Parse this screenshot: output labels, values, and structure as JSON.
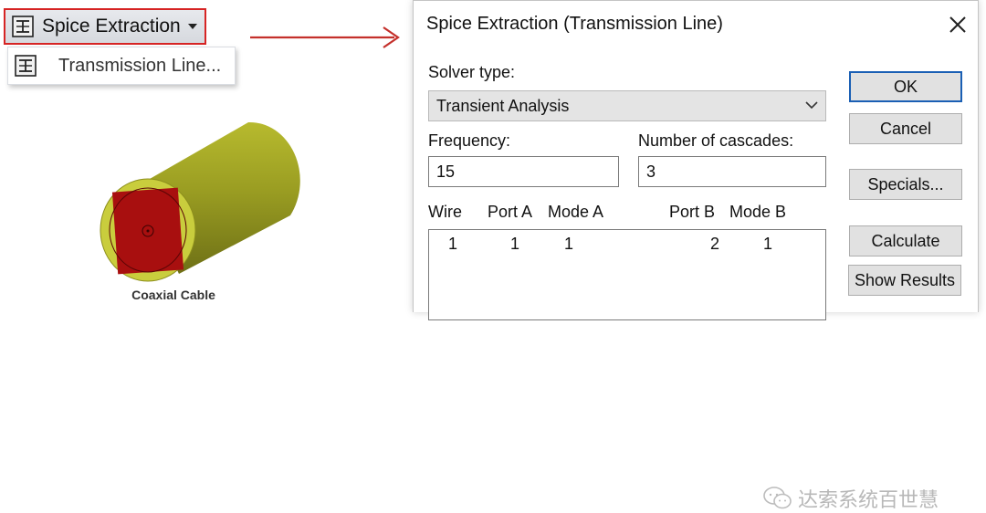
{
  "toolbar": {
    "button_label": "Spice Extraction",
    "menu_item_label": "Transmission Line..."
  },
  "figure": {
    "caption": "Coaxial Cable"
  },
  "dialog": {
    "title": "Spice Extraction (Transmission Line)",
    "solver_type_label": "Solver type:",
    "solver_type_value": "Transient Analysis",
    "frequency_label": "Frequency:",
    "frequency_value": "15",
    "cascades_label": "Number of cascades:",
    "cascades_value": "3",
    "buttons": {
      "ok": "OK",
      "cancel": "Cancel",
      "specials": "Specials...",
      "calculate": "Calculate",
      "show_results": "Show Results"
    },
    "table": {
      "headers": [
        "Wire",
        "Port A",
        "Mode A",
        "Port B",
        "Mode B"
      ],
      "rows": [
        [
          "1",
          "1",
          "1",
          "2",
          "1"
        ]
      ]
    }
  },
  "watermark": {
    "text": "达索系统百世慧"
  },
  "colors": {
    "highlight_red": "#d62424",
    "cable_yellow": "#c8cc3c",
    "cable_dark_red": "#a80f0f",
    "dialog_default_blue": "#1a5fb4"
  },
  "icons": {
    "toolbar": "spice-extraction-icon",
    "menu": "transmission-line-icon",
    "dialog_close": "close-icon",
    "select": "chevron-down-icon",
    "watermark": "wechat-icon"
  }
}
